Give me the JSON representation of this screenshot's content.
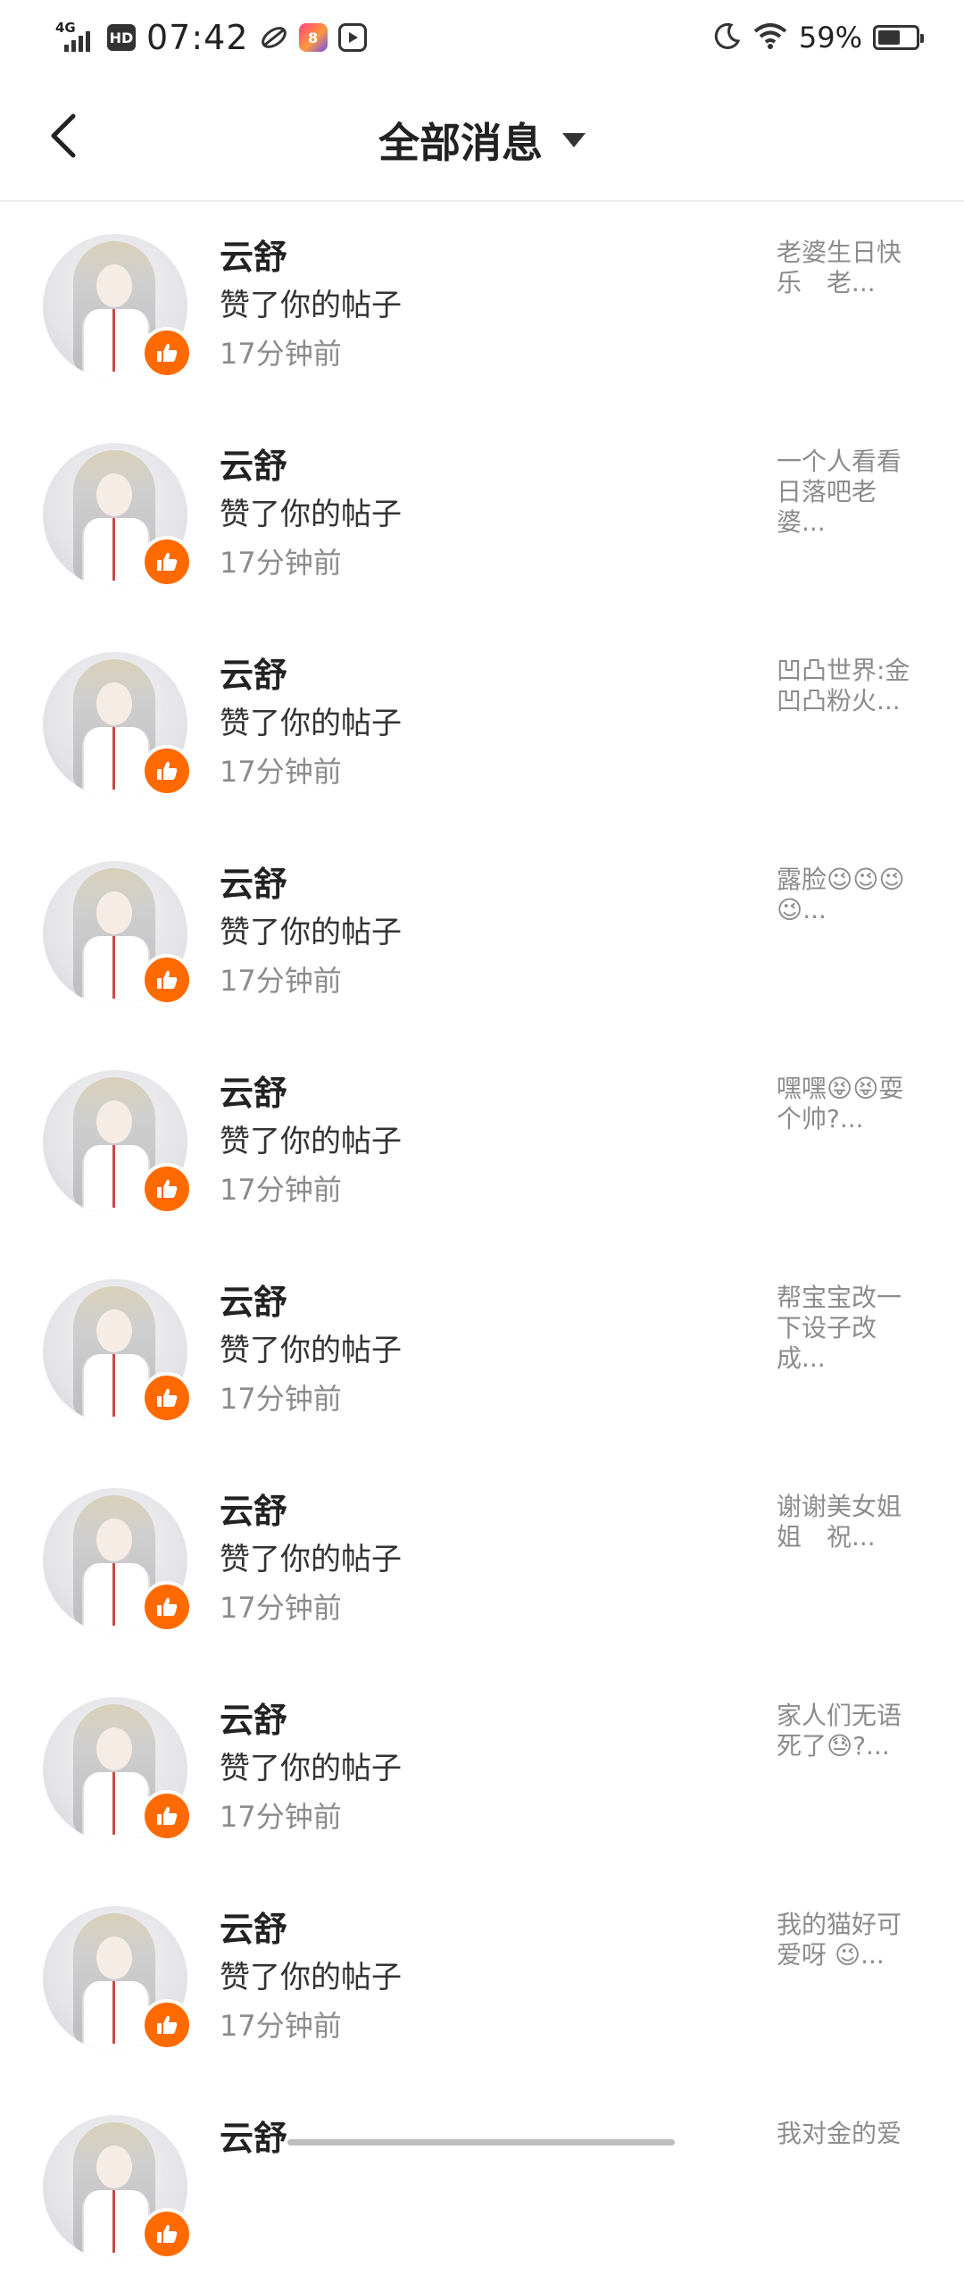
{
  "status_bar": {
    "network": "4G",
    "hd": "HD",
    "time": "07:42",
    "app_badge": "8",
    "battery_percent": "59%",
    "battery_level": 0.59,
    "icons": [
      "signal-icon",
      "hd-icon",
      "leaf-app-icon",
      "colorful-app-icon",
      "play-app-icon",
      "moon-icon",
      "wifi-icon",
      "battery-icon"
    ]
  },
  "header": {
    "title": "全部消息",
    "back_icon": "chevron-left-icon",
    "dropdown_icon": "triangle-down-icon"
  },
  "colors": {
    "like_badge": "#ff6a00",
    "muted_text": "#8c8c8c",
    "divider": "#ececec"
  },
  "notifications": [
    {
      "name": "云舒",
      "action": "赞了你的帖子",
      "time": "17分钟前",
      "preview": "老婆生日快乐　老..."
    },
    {
      "name": "云舒",
      "action": "赞了你的帖子",
      "time": "17分钟前",
      "preview": "一个人看看日落吧老婆..."
    },
    {
      "name": "云舒",
      "action": "赞了你的帖子",
      "time": "17分钟前",
      "preview": "凹凸世界:金凹凸粉火..."
    },
    {
      "name": "云舒",
      "action": "赞了你的帖子",
      "time": "17分钟前",
      "preview": "露脸😉😉😉😉..."
    },
    {
      "name": "云舒",
      "action": "赞了你的帖子",
      "time": "17分钟前",
      "preview": "嘿嘿😝😝耍个帅?..."
    },
    {
      "name": "云舒",
      "action": "赞了你的帖子",
      "time": "17分钟前",
      "preview": "帮宝宝改一下设子改成..."
    },
    {
      "name": "云舒",
      "action": "赞了你的帖子",
      "time": "17分钟前",
      "preview": "谢谢美女姐姐　祝..."
    },
    {
      "name": "云舒",
      "action": "赞了你的帖子",
      "time": "17分钟前",
      "preview": "家人们无语死了😓?..."
    },
    {
      "name": "云舒",
      "action": "赞了你的帖子",
      "time": "17分钟前",
      "preview": "我的猫好可爱呀 😉..."
    },
    {
      "name": "云舒",
      "action": "",
      "time": "",
      "preview": "我对金的爱"
    }
  ]
}
